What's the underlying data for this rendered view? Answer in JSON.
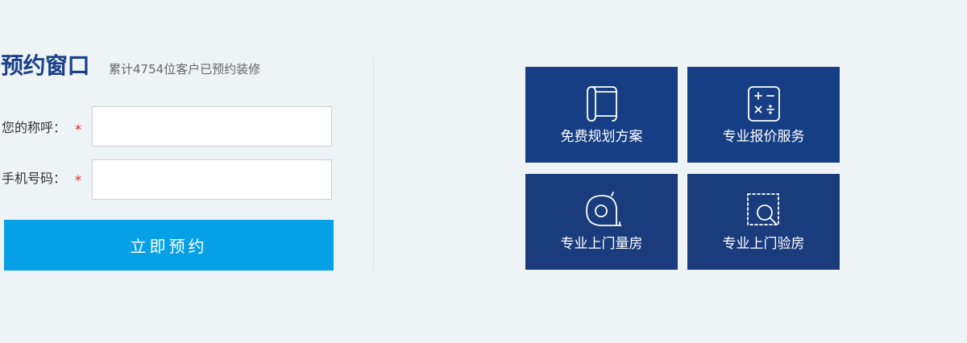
{
  "form": {
    "title": "预约窗口",
    "subtitle": "累计4754位客户已预约装修",
    "name_label": "您的称呼：",
    "phone_label": "手机号码：",
    "required_mark": "*",
    "name_value": "",
    "phone_value": "",
    "submit_label": "立即预约"
  },
  "services": [
    {
      "label": "免费规划方案",
      "icon": "blueprint-scroll-icon"
    },
    {
      "label": "专业报价服务",
      "icon": "calculator-icon"
    },
    {
      "label": "专业上门量房",
      "icon": "tape-measure-icon"
    },
    {
      "label": "专业上门验房",
      "icon": "inspection-magnifier-icon"
    }
  ],
  "colors": {
    "page_bg": "#eef3f6",
    "title": "#1a4088",
    "submit_bg": "#05a0e6",
    "tile_bg": "#163e84",
    "required": "#e02020"
  }
}
